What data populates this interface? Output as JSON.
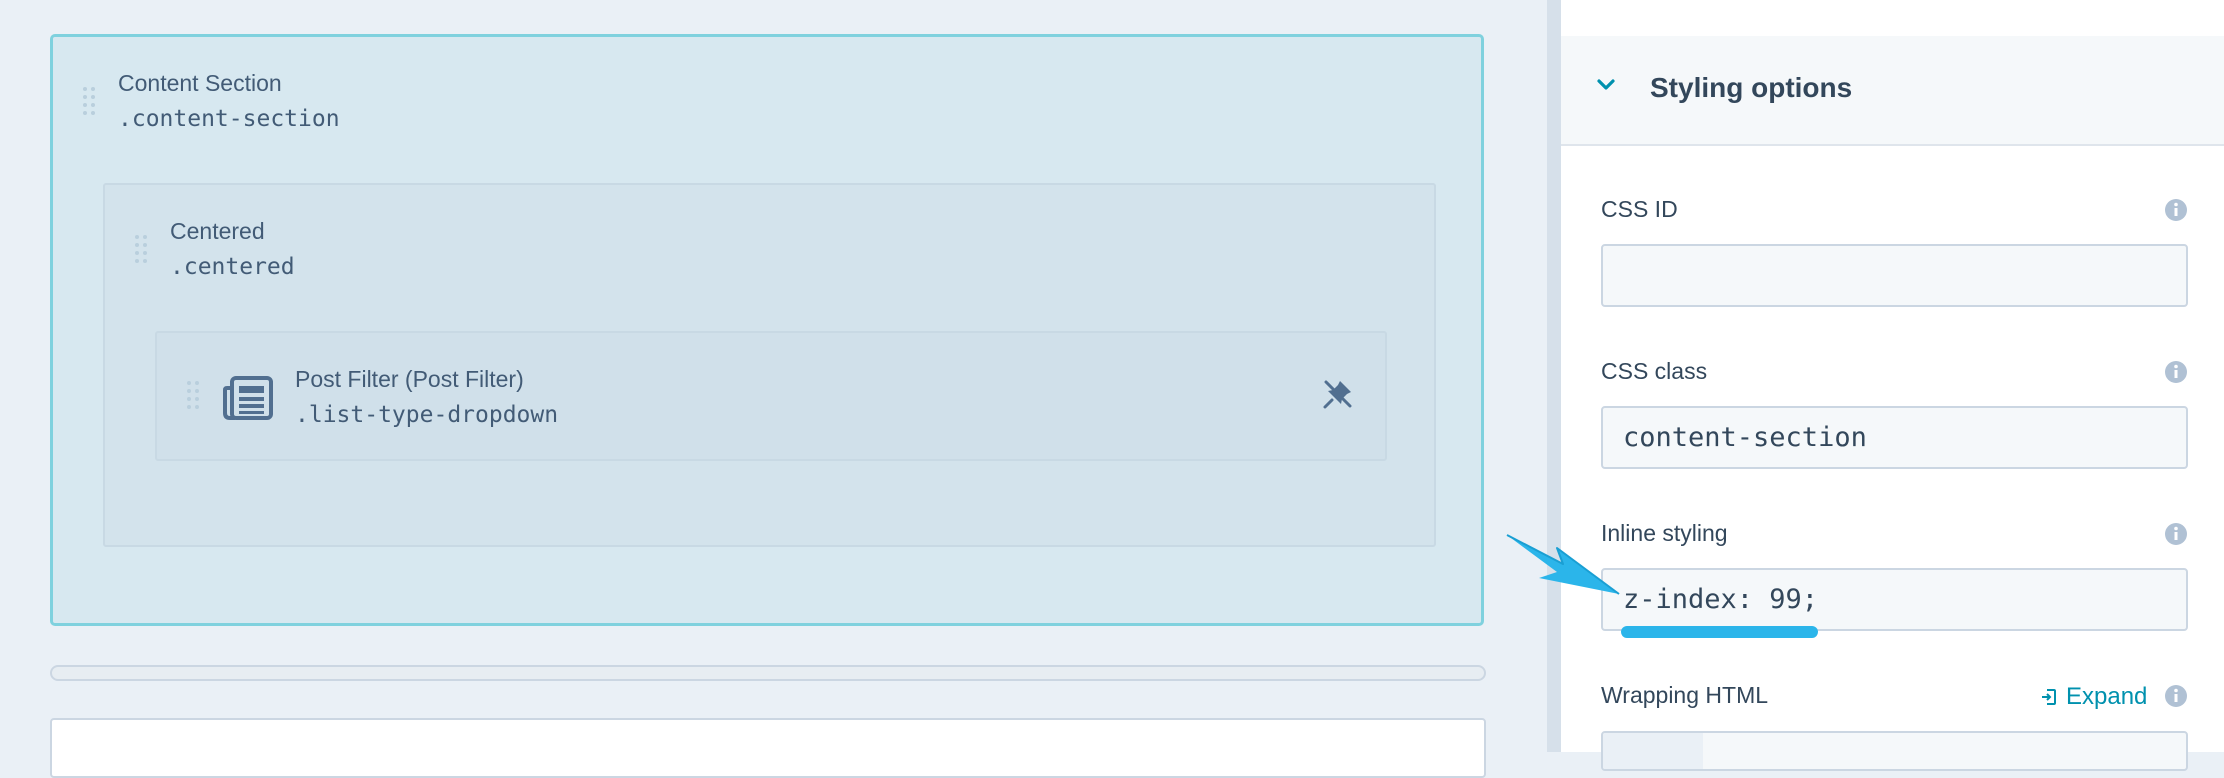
{
  "canvas": {
    "section": {
      "title": "Content Section",
      "class_name": ".content-section"
    },
    "centered": {
      "title": "Centered",
      "class_name": ".centered"
    },
    "module": {
      "title": "Post Filter (Post Filter)",
      "class_name": ".list-type-dropdown"
    }
  },
  "panel": {
    "header": {
      "title": "Styling options"
    },
    "fields": {
      "css_id": {
        "label": "CSS ID",
        "value": ""
      },
      "css_class": {
        "label": "CSS class",
        "value": "content-section"
      },
      "inline_styling": {
        "label": "Inline styling",
        "value": "z-index: 99;"
      },
      "wrapping_html": {
        "label": "Wrapping HTML",
        "expand_label": "Expand"
      }
    }
  },
  "colors": {
    "accent": "#0091ae",
    "annotation": "#2bb5ea",
    "selection_border": "#7fd1de"
  },
  "icons": [
    "drag-handle-icon",
    "list-module-icon",
    "unpin-icon",
    "chevron-down-icon",
    "info-icon",
    "expand-icon"
  ]
}
